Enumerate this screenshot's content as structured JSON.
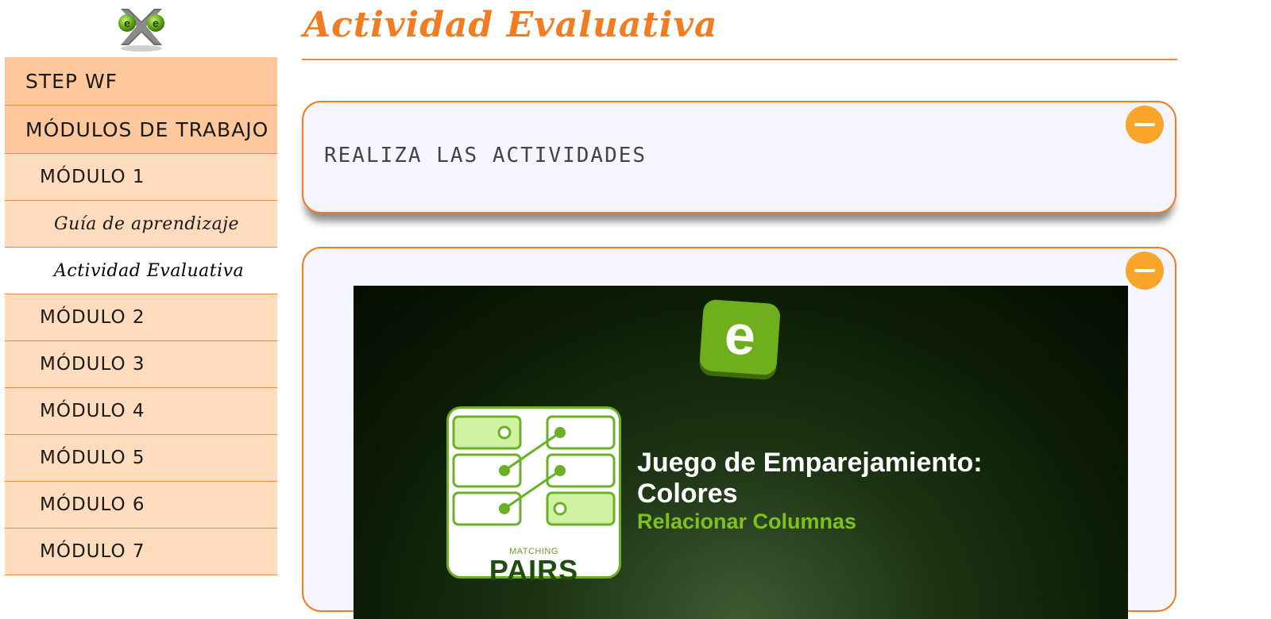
{
  "app": {
    "logo_icon": "exe-logo-icon"
  },
  "sidebar": {
    "items": [
      {
        "label": "STEP WF",
        "level": "top"
      },
      {
        "label": "MÓDULOS DE TRABAJO",
        "level": "top"
      },
      {
        "label": "MÓDULO 1",
        "level": "module"
      },
      {
        "label": "Guía de aprendizaje",
        "level": "sub"
      },
      {
        "label": "Actividad Evaluativa",
        "level": "sub",
        "active": true
      },
      {
        "label": "MÓDULO 2",
        "level": "module"
      },
      {
        "label": "MÓDULO 3",
        "level": "module"
      },
      {
        "label": "MÓDULO 4",
        "level": "module"
      },
      {
        "label": "MÓDULO 5",
        "level": "module"
      },
      {
        "label": "MÓDULO 6",
        "level": "module"
      },
      {
        "label": "MÓDULO 7",
        "level": "module"
      }
    ]
  },
  "main": {
    "title": "Actividad Evaluativa",
    "box1": {
      "text": "REALIZA LAS ACTIVIDADES",
      "toggle_icon": "minus-icon"
    },
    "box2": {
      "toggle_icon": "minus-icon",
      "activity": {
        "logo_letter": "e",
        "card_subtitle": "MATCHING",
        "card_title": "PAIRS",
        "title": "Juego de Emparejamiento: Colores",
        "subtitle": "Relacionar Columnas"
      }
    }
  },
  "colors": {
    "accent": "#f47b20",
    "sidebar_top": "#ffc89c",
    "sidebar_item": "#ffdcbd",
    "toggle": "#f9a52a",
    "box_bg": "#f5f5ff",
    "activity_green": "#6fae1d"
  }
}
